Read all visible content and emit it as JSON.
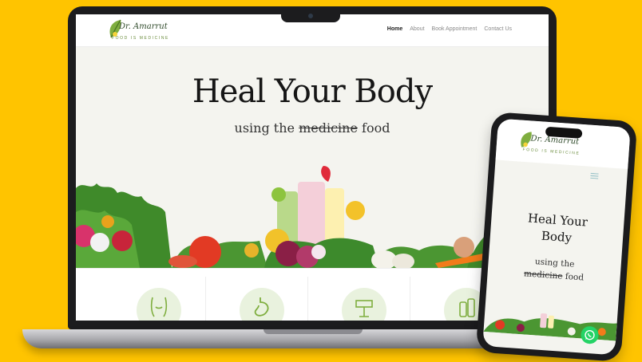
{
  "brand": {
    "name": "Dr. Amarrut",
    "tagline": "FOOD IS MEDICINE"
  },
  "nav": [
    {
      "label": "Home",
      "active": true
    },
    {
      "label": "About",
      "active": false
    },
    {
      "label": "Book Appointment",
      "active": false
    },
    {
      "label": "Contact Us",
      "active": false
    }
  ],
  "hero": {
    "title": "Heal Your Body",
    "subtitle_prefix": "using the",
    "subtitle_struck": "medicine",
    "subtitle_suffix": "food"
  },
  "mobile": {
    "title_line1": "Heal Your",
    "title_line2": "Body",
    "sub_line1": "using the",
    "sub_struck": "medicine",
    "sub_suffix": "food"
  },
  "features": [
    {
      "icon": "body-icon"
    },
    {
      "icon": "stomach-icon"
    },
    {
      "icon": "sign-icon"
    },
    {
      "icon": "bottle-icon"
    }
  ],
  "colors": {
    "background": "#ffc400",
    "brand_green": "#6a8c3c",
    "whatsapp": "#25d366"
  }
}
